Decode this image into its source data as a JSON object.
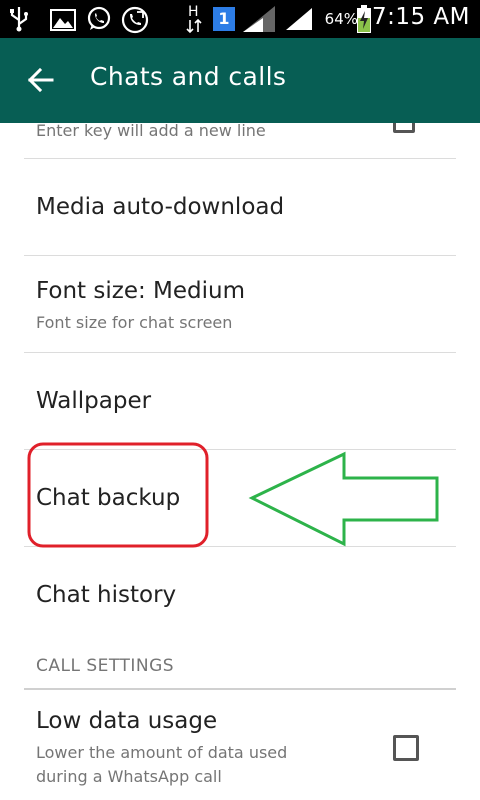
{
  "status_bar": {
    "battery_percent": "64%",
    "time": "7:15 AM",
    "network_type": "H",
    "notification_count": "1",
    "icons": [
      "usb-icon",
      "gallery-icon",
      "whatsapp-icon",
      "missed-call-icon",
      "data-arrows-icon",
      "sim-notification-icon",
      "signal-icon",
      "signal-icon",
      "battery-charging-icon"
    ]
  },
  "app_bar": {
    "title": "Chats and calls",
    "background_color": "#075e54",
    "back_icon": "arrow-left-icon"
  },
  "settings": {
    "partial_item": {
      "subtitle": "Enter key will add a new line"
    },
    "items": [
      {
        "title": "Media auto-download"
      },
      {
        "title": "Font size: Medium",
        "subtitle": "Font size for chat screen"
      },
      {
        "title": "Wallpaper"
      },
      {
        "title": "Chat backup"
      },
      {
        "title": "Chat history"
      }
    ],
    "call_section": {
      "header": "CALL SETTINGS",
      "low_data": {
        "title": "Low data usage",
        "subtitle_line1": "Lower the amount of data used",
        "subtitle_line2": "during a WhatsApp call",
        "checked": false
      }
    }
  },
  "annotations": {
    "highlight_color": "#e0202a",
    "arrow_color": "#2db34a"
  }
}
